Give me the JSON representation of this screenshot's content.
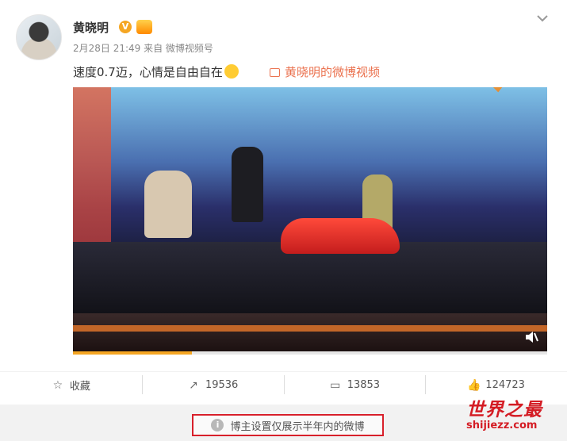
{
  "post": {
    "author": "黄晓明",
    "meta": "2月28日 21:49 来自 微博视频号",
    "text": "速度0.7迈，心情是自由自在",
    "video_link": "黄晓明的微博视频",
    "verified_badge": "V",
    "more_icon": "chevron-down-icon"
  },
  "video": {
    "progress_fraction": 0.25
  },
  "actions": {
    "favorite": "收藏",
    "repost": "19536",
    "comment": "13853",
    "like": "124723"
  },
  "notice": {
    "text": "博主设置仅展示半年内的微博",
    "info_glyph": "i"
  },
  "watermark": {
    "title": "世界之最",
    "url": "shijiezz.com"
  },
  "colors": {
    "link": "#eb7350",
    "notice_border": "#d8202b",
    "watermark": "#d41c24"
  }
}
